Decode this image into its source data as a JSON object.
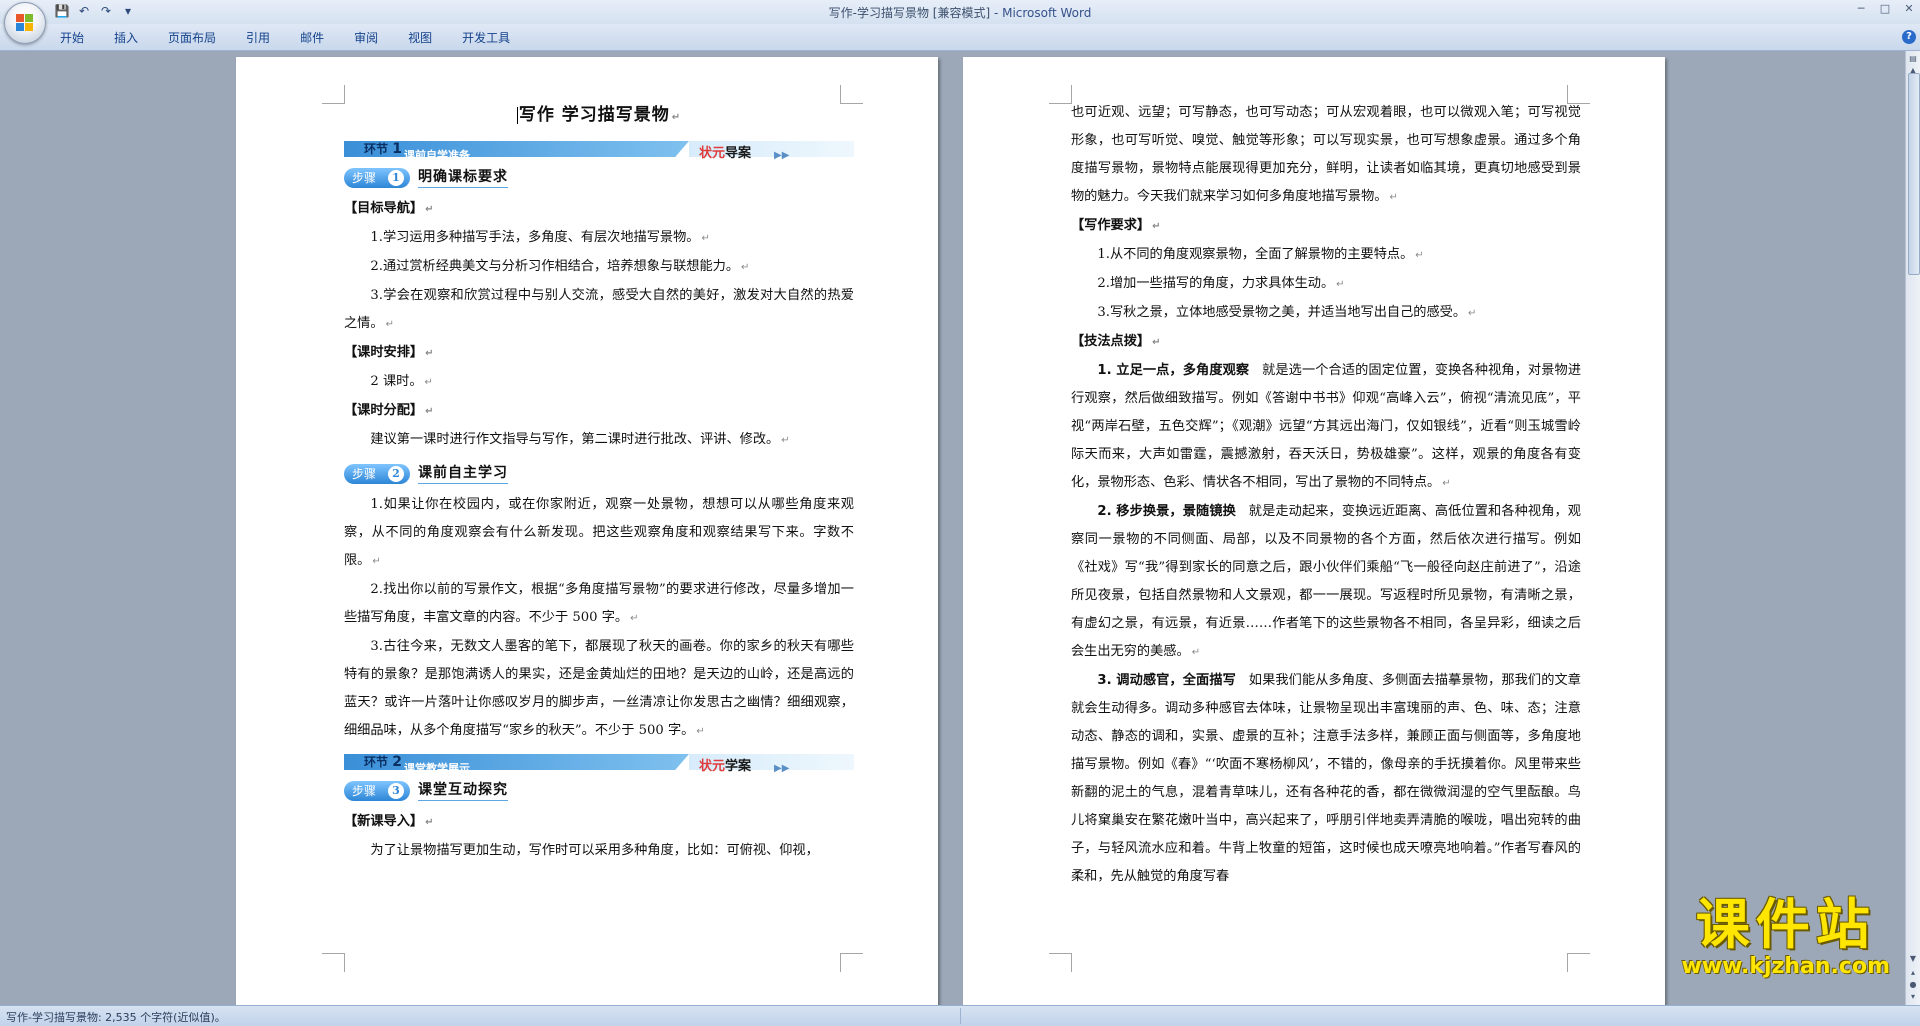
{
  "window": {
    "title": "写作-学习描写景物 [兼容模式]",
    "app_name": " - Microsoft Word",
    "controls": [
      "─",
      "□",
      "✕"
    ]
  },
  "ribbon": {
    "tabs": [
      "开始",
      "插入",
      "页面布局",
      "引用",
      "邮件",
      "审阅",
      "视图",
      "开发工具"
    ],
    "help": "?"
  },
  "left_page": {
    "title": "写作  学习描写景物",
    "band1": {
      "prefix": "环节",
      "num": "1",
      "label": "课前自学准备",
      "tail_a": "状元",
      "tail_b": "导案"
    },
    "step1": {
      "pill": "步骤",
      "num": "1",
      "title": "明确课标要求"
    },
    "goal_heading": "【目标导航】",
    "goals": [
      "1.学习运用多种描写手法，多角度、有层次地描写景物。",
      "2.通过赏析经典美文与分析习作相结合，培养想象与联想能力。",
      "3.学会在观察和欣赏过程中与别人交流，感受大自然的美好，激发对大自然的热爱之情。"
    ],
    "schedule_heading": "【课时安排】",
    "schedule": "2 课时。",
    "allocation_heading": "【课时分配】",
    "allocation": "建议第一课时进行作文指导与写作，第二课时进行批改、评讲、修改。",
    "step2": {
      "pill": "步骤",
      "num": "2",
      "title": "课前自主学习"
    },
    "tasks": [
      "1.如果让你在校园内，或在你家附近，观察一处景物，想想可以从哪些角度来观察，从不同的角度观察会有什么新发现。把这些观察角度和观察结果写下来。字数不限。",
      "2.找出你以前的写景作文，根据“多角度描写景物”的要求进行修改，尽量多增加一些描写角度，丰富文章的内容。不少于 500 字。",
      "3.古往今来，无数文人墨客的笔下，都展现了秋天的画卷。你的家乡的秋天有哪些特有的景象？是那饱满诱人的果实，还是金黄灿烂的田地？是天边的山岭，还是高远的蓝天？或许一片落叶让你感叹岁月的脚步声，一丝清凉让你发思古之幽情？细细观察，细细品味，从多个角度描写“家乡的秋天”。不少于 500 字。"
    ],
    "band2": {
      "prefix": "环节",
      "num": "2",
      "label": "课堂教学展示",
      "tail_a": "状元",
      "tail_b": "学案"
    },
    "step3": {
      "pill": "步骤",
      "num": "3",
      "title": "课堂互动探究"
    },
    "intro_heading": "【新课导入】",
    "intro": "为了让景物描写更加生动，写作时可以采用多种角度，比如：可俯视、仰视，"
  },
  "right_page": {
    "intro_cont": "也可近观、远望；可写静态，也可写动态；可从宏观着眼，也可以微观入笔；可写视觉形象，也可写听觉、嗅觉、触觉等形象；可以写现实景，也可写想象虚景。通过多个角度描写景物，景物特点能展现得更加充分，鲜明，让读者如临其境，更真切地感受到景物的魅力。今天我们就来学习如何多角度地描写景物。",
    "req_heading": "【写作要求】",
    "requirements": [
      "1.从不同的角度观察景物，全面了解景物的主要特点。",
      "2.增加一些描写的角度，力求具体生动。",
      "3.写秋之景，立体地感受景物之美，并适当地写出自己的感受。"
    ],
    "tips_heading": "【技法点拨】",
    "tips": [
      {
        "lead": "1. 立足一点，多角度观察",
        "body": "就是选一个合适的固定位置，变换各种视角，对景物进行观察，然后做细致描写。例如《答谢中书书》仰观“高峰入云”，俯视“清流见底”，平视“两岸石壁，五色交辉”；《观潮》远望“方其远出海门，仅如银线”，近看“则玉城雪岭际天而来，大声如雷霆，震撼激射，吞天沃日，势极雄豪”。这样，观景的角度各有变化，景物形态、色彩、情状各不相同，写出了景物的不同特点。"
      },
      {
        "lead": "2. 移步换景，景随镜换",
        "body": "就是走动起来，变换远近距离、高低位置和各种视角，观察同一景物的不同侧面、局部，以及不同景物的各个方面，然后依次进行描写。例如《社戏》写“我”得到家长的同意之后，跟小伙伴们乘船“飞一般径向赵庄前进了”，沿途所见夜景，包括自然景物和人文景观，都一一展现。写返程时所见景物，有清晰之景，有虚幻之景，有远景，有近景……作者笔下的这些景物各不相同，各呈异彩，细读之后会生出无穷的美感。"
      },
      {
        "lead": "3. 调动感官，全面描写",
        "body": "如果我们能从多角度、多侧面去描摹景物，那我们的文章就会生动得多。调动多种感官去体味，让景物呈现出丰富瑰丽的声、色、味、态；注意动态、静态的调和，实景、虚景的互补；注意手法多样，兼顾正面与侧面等，多角度地描写景物。例如《春》“‘吹面不寒杨柳风’，不错的，像母亲的手抚摸着你。风里带来些新翻的泥土的气息，混着青草味儿，还有各种花的香，都在微微润湿的空气里酝酿。鸟儿将窠巢安在繁花嫩叶当中，高兴起来了，呼朋引伴地卖弄清脆的喉咙，唱出宛转的曲子，与轻风流水应和着。牛背上牧童的短笛，这时候也成天嘹亮地响着。”作者写春风的柔和，先从触觉的角度写春"
      }
    ]
  },
  "status": {
    "text": "写作-学习描写景物: 2,535 个字符(近似值)。"
  },
  "watermark": {
    "main": "课件站",
    "url": "www.kjzhan.com"
  },
  "colors": {
    "accent": "#2d86d6",
    "band": "#3a8fd8",
    "watermark": "#ffe600"
  }
}
